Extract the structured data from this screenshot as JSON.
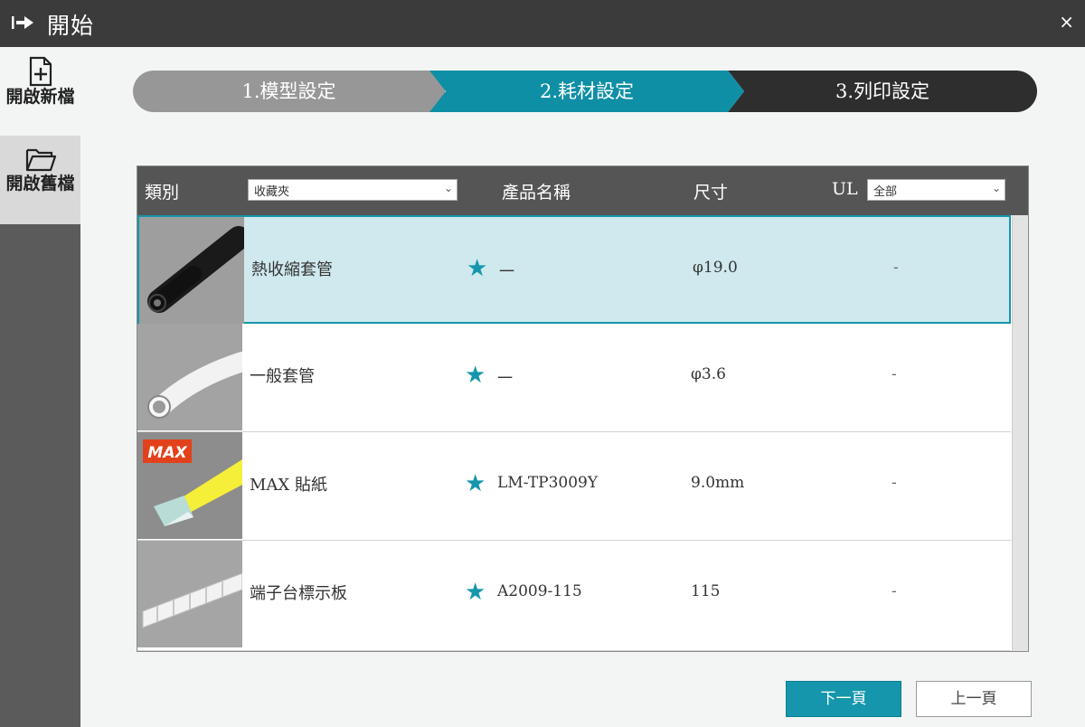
{
  "window": {
    "title": "開始",
    "close_label": "×"
  },
  "sidebar": {
    "items": [
      {
        "label": "開啟新檔",
        "icon": "new-file-icon"
      },
      {
        "label": "開啟舊檔",
        "icon": "open-folder-icon"
      }
    ]
  },
  "steps": [
    {
      "label": "1.模型設定",
      "state": "done"
    },
    {
      "label": "2.耗材設定",
      "state": "active"
    },
    {
      "label": "3.列印設定",
      "state": "pending"
    }
  ],
  "table": {
    "headers": {
      "category": "類別",
      "product_name": "產品名稱",
      "size": "尺寸",
      "ul": "UL"
    },
    "category_filter": {
      "selected": "收藏夾"
    },
    "ul_filter": {
      "selected": "全部"
    },
    "rows": [
      {
        "category": "熱收縮套管",
        "name": "一",
        "size": "φ19.0",
        "ul": "-",
        "selected": true,
        "thumb": "heat-shrink-tube"
      },
      {
        "category": "一般套管",
        "name": "一",
        "size": "φ3.6",
        "ul": "-",
        "selected": false,
        "thumb": "white-tube"
      },
      {
        "category": "MAX 貼紙",
        "name": "LM-TP3009Y",
        "size": "9.0mm",
        "ul": "-",
        "selected": false,
        "thumb": "max-sticker"
      },
      {
        "category": "端子台標示板",
        "name": "A2009-115",
        "size": "115",
        "ul": "-",
        "selected": false,
        "thumb": "terminal-marker"
      }
    ],
    "star_glyph": "★"
  },
  "buttons": {
    "next": "下一頁",
    "prev": "上一頁"
  },
  "colors": {
    "accent": "#1596ac",
    "titlebar": "#3b3b3b",
    "selected_row": "#cfe9ee"
  }
}
